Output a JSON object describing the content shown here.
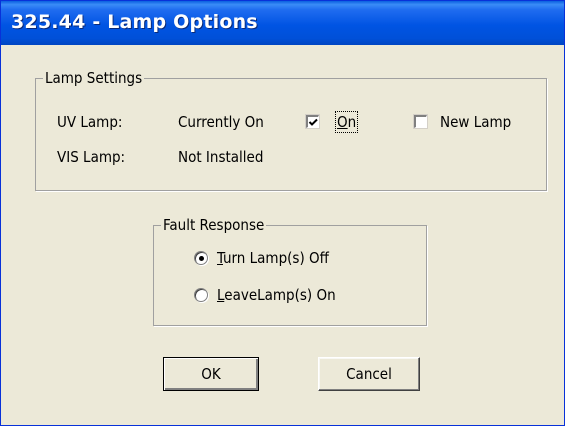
{
  "window": {
    "title": "325.44 - Lamp Options"
  },
  "lamp_settings": {
    "legend": "Lamp Settings",
    "uv_label": "UV Lamp:",
    "uv_status": "Currently On",
    "vis_label": "VIS Lamp:",
    "vis_status": "Not Installed",
    "on_checkbox": {
      "label_first": "O",
      "label_rest": "n",
      "checked": true
    },
    "new_lamp_checkbox": {
      "label": "New Lamp",
      "checked": false
    }
  },
  "fault_response": {
    "legend": "Fault Response",
    "options": [
      {
        "mnemonic": "T",
        "label_rest": "urn Lamp(s) Off",
        "selected": true
      },
      {
        "mnemonic": "L",
        "label_rest": "eaveLamp(s) On",
        "selected": false
      }
    ]
  },
  "buttons": {
    "ok": "OK",
    "cancel": "Cancel"
  }
}
